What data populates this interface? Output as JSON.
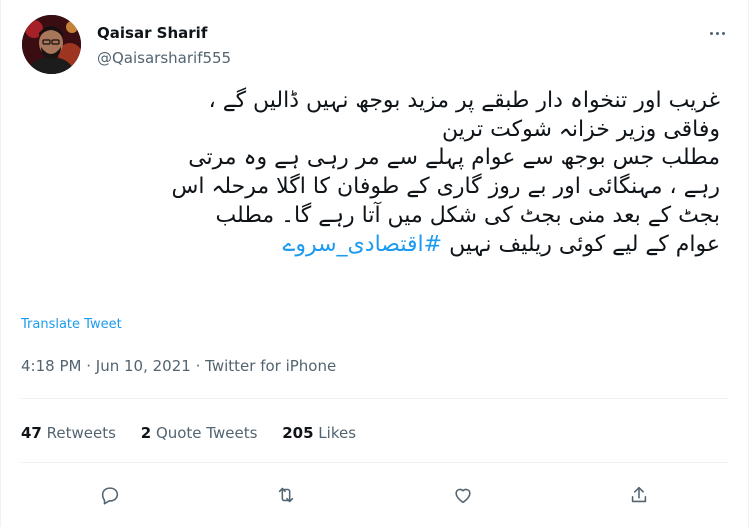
{
  "author": {
    "name": "Qaisar Sharif",
    "handle": "@Qaisarsharif555",
    "avatar_icon": "profile-photo"
  },
  "more_icon": "more-horizontal-icon",
  "tweet": {
    "lines": [
      "غریب اور تنخواہ دار طبقے پر مزید بوجھ نہیں ڈالیں گے ،",
      "وفاقی وزیر خزانہ شوکت ترین",
      "مطلب جس بوجھ سے عوام پہلے سے مر رہی ہے وہ مرتی",
      "رہے ، مہنگائی اور بے روز گاری کے طوفان کا اگلا مرحلہ اس",
      "بجٹ کے بعد منی بجٹ کی شکل میں آتا رہے گا۔ مطلب"
    ],
    "last_line_text": "عوام کے لیے کوئی ریلیف نہیں",
    "hashtag": "#اقتصادی_سروے"
  },
  "translate_label": "Translate Tweet",
  "meta": {
    "time": "4:18 PM",
    "date": "Jun 10, 2021",
    "source": "Twitter for iPhone",
    "separator": "·"
  },
  "stats": {
    "retweets_count": "47",
    "retweets_label": "Retweets",
    "quotes_count": "2",
    "quotes_label": "Quote Tweets",
    "likes_count": "205",
    "likes_label": "Likes"
  },
  "actions": [
    "reply-icon",
    "retweet-icon",
    "like-icon",
    "share-icon"
  ],
  "colors": {
    "accent": "#1d9bf0",
    "secondary_text": "#536471",
    "primary_text": "#0f1419",
    "divider": "#eff3f4"
  }
}
